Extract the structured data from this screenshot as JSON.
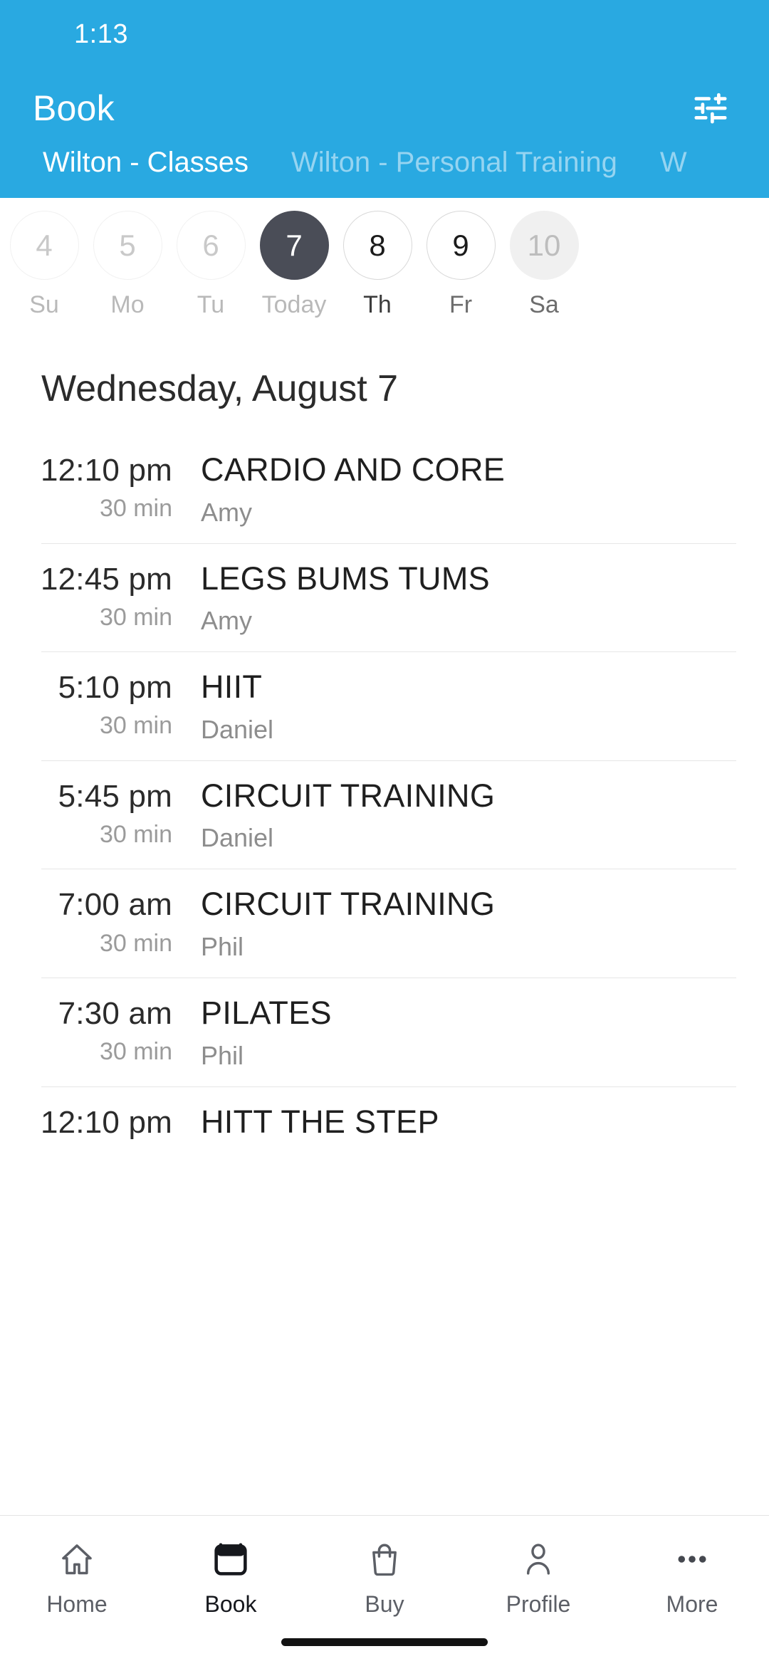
{
  "theme": {
    "header_blue": "#29a9e1",
    "tab_inactive": "#95d4f1",
    "today_circle": "#4a4d57",
    "muted_text": "#9b9b9b"
  },
  "status_bar": {
    "time": "1:13"
  },
  "app_bar": {
    "title": "Book",
    "filter_icon": "tune-filter-icon"
  },
  "location_tabs": [
    {
      "label": "Wilton - Classes",
      "active": true
    },
    {
      "label": "Wilton - Personal Training",
      "active": false
    },
    {
      "label": "W",
      "active": false
    }
  ],
  "date_strip": [
    {
      "day_number": "4",
      "weekday": "Su",
      "state": "past"
    },
    {
      "day_number": "5",
      "weekday": "Mo",
      "state": "past"
    },
    {
      "day_number": "6",
      "weekday": "Tu",
      "state": "past"
    },
    {
      "day_number": "7",
      "weekday": "Today",
      "state": "today"
    },
    {
      "day_number": "8",
      "weekday": "Th",
      "state": "future"
    },
    {
      "day_number": "9",
      "weekday": "Fr",
      "state": "future"
    },
    {
      "day_number": "10",
      "weekday": "Sa",
      "state": "edge"
    }
  ],
  "day_heading": "Wednesday, August 7",
  "classes": [
    {
      "time": "12:10 pm",
      "duration": "30 min",
      "title": "CARDIO AND CORE",
      "instructor": "Amy"
    },
    {
      "time": "12:45 pm",
      "duration": "30 min",
      "title": "LEGS BUMS TUMS",
      "instructor": "Amy"
    },
    {
      "time": "5:10 pm",
      "duration": "30 min",
      "title": "HIIT",
      "instructor": "Daniel"
    },
    {
      "time": "5:45 pm",
      "duration": "30 min",
      "title": "CIRCUIT TRAINING",
      "instructor": "Daniel"
    },
    {
      "time": "7:00 am",
      "duration": "30 min",
      "title": "CIRCUIT TRAINING",
      "instructor": "Phil"
    },
    {
      "time": "7:30 am",
      "duration": "30 min",
      "title": "PILATES",
      "instructor": "Phil"
    },
    {
      "time": "12:10 pm",
      "duration": "",
      "title": "HITT THE STEP",
      "instructor": ""
    }
  ],
  "bottom_nav": [
    {
      "label": "Home",
      "icon": "home-icon",
      "active": false
    },
    {
      "label": "Book",
      "icon": "calendar-icon",
      "active": true
    },
    {
      "label": "Buy",
      "icon": "shopping-bag-icon",
      "active": false
    },
    {
      "label": "Profile",
      "icon": "person-icon",
      "active": false
    },
    {
      "label": "More",
      "icon": "more-dots-icon",
      "active": false
    }
  ]
}
